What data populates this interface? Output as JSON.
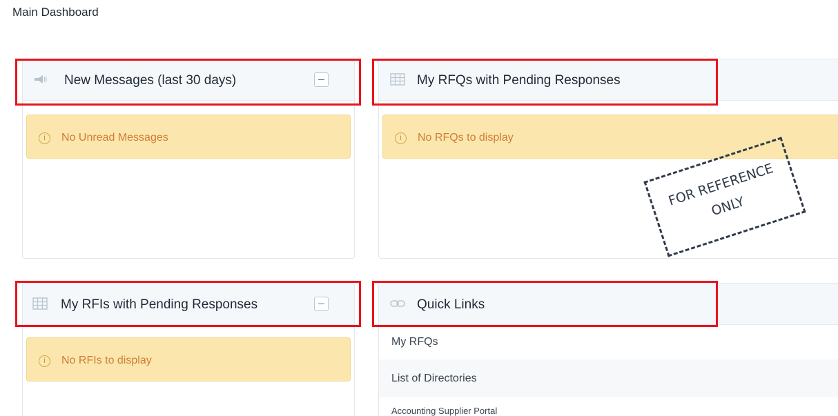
{
  "page": {
    "title": "Main Dashboard"
  },
  "panels": {
    "messages": {
      "title": "New Messages (last 30 days)",
      "icon": "megaphone-icon",
      "alert": "No Unread Messages"
    },
    "rfqs": {
      "title": "My RFQs with Pending Responses",
      "icon": "table-grid-icon",
      "alert": "No RFQs to display"
    },
    "rfis": {
      "title": "My RFIs with Pending Responses",
      "icon": "table-grid-icon",
      "alert": "No RFIs to display"
    },
    "quick_links": {
      "title": "Quick Links",
      "icon": "link-icon",
      "items": [
        "My RFQs",
        "List of Directories",
        "Accounting Supplier Portal"
      ]
    }
  },
  "stamp": {
    "line1": "FOR REFERENCE",
    "line2": "ONLY"
  },
  "colors": {
    "highlight_box": "#e8141c",
    "alert_bg": "#fbe7ae",
    "alert_text": "#cf7d33",
    "header_bg": "#f5f8fb"
  }
}
